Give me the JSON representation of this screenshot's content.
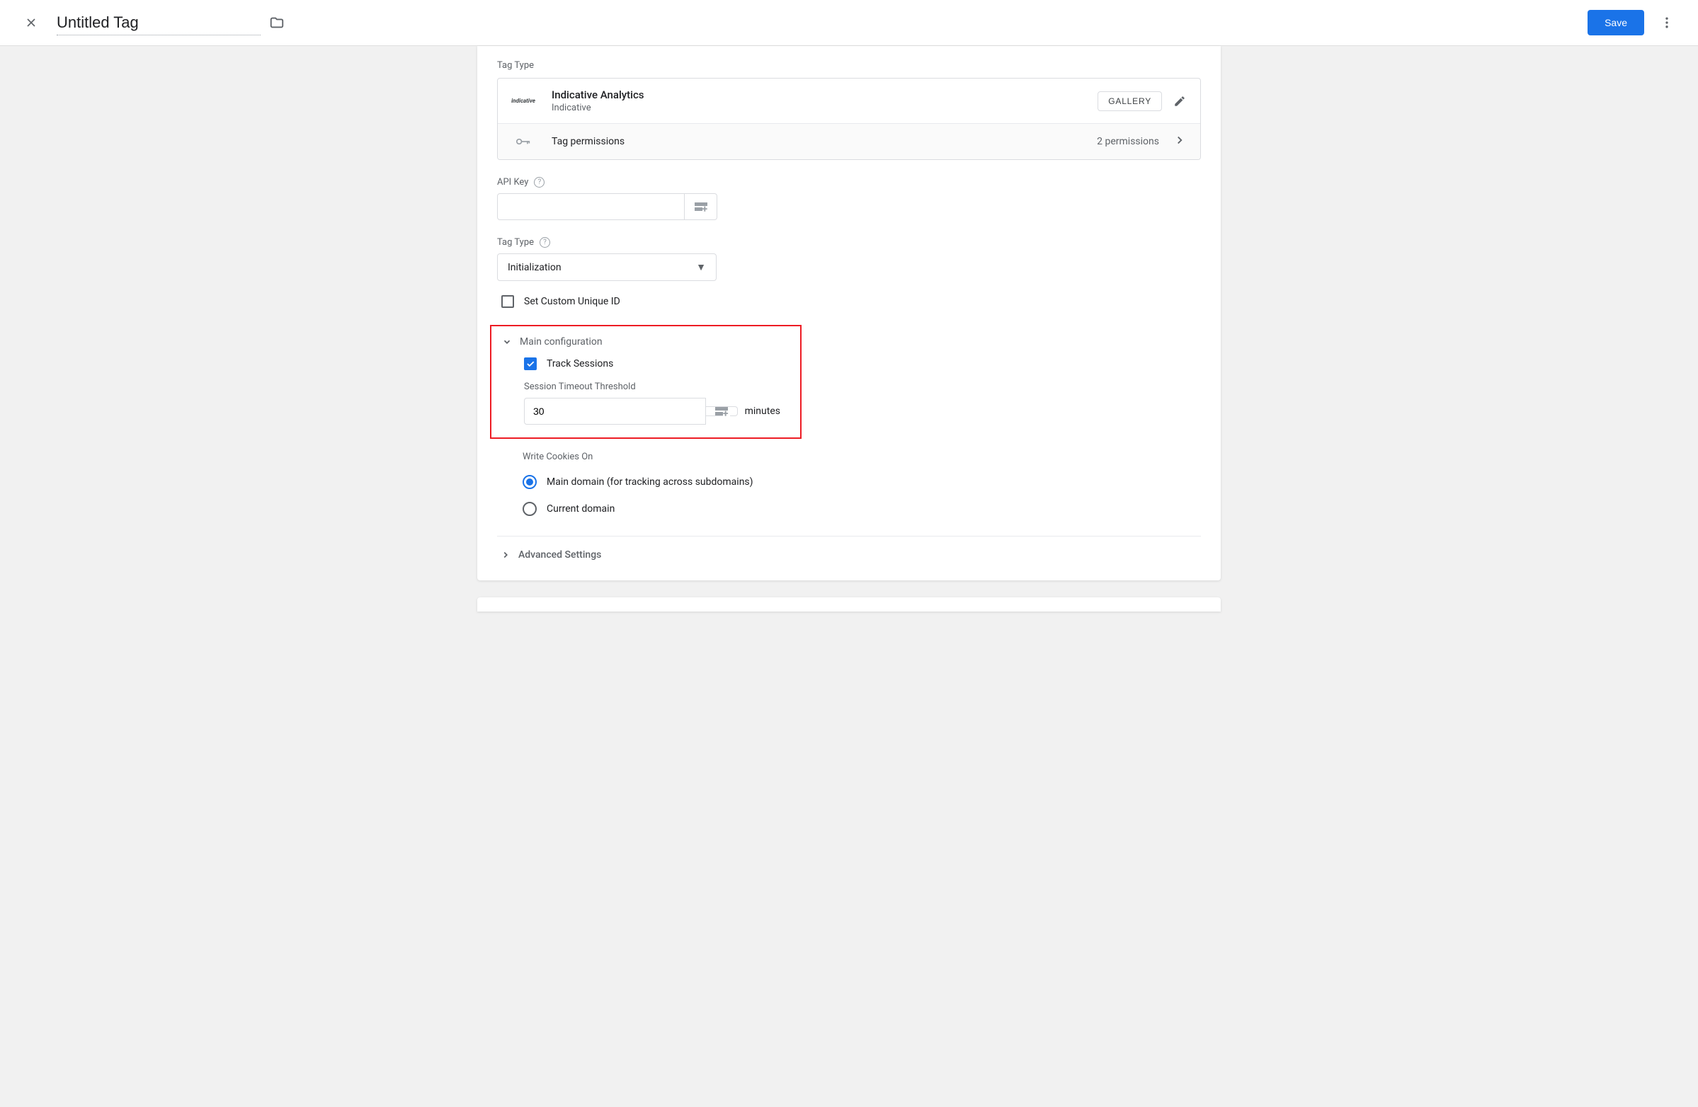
{
  "header": {
    "title": "Untitled Tag",
    "save_label": "Save"
  },
  "tagType": {
    "sectionLabel": "Tag Type",
    "name": "Indicative Analytics",
    "vendor": "Indicative",
    "galleryLabel": "GALLERY",
    "permissionsLabel": "Tag permissions",
    "permissionsCount": "2 permissions"
  },
  "apiKey": {
    "label": "API Key",
    "value": ""
  },
  "tagTypeField": {
    "label": "Tag Type",
    "value": "Initialization"
  },
  "customId": {
    "label": "Set Custom Unique ID"
  },
  "mainConfig": {
    "label": "Main configuration",
    "trackSessions": "Track Sessions",
    "sessionTimeoutLabel": "Session Timeout Threshold",
    "sessionTimeoutValue": "30",
    "minutesLabel": "minutes"
  },
  "cookies": {
    "label": "Write Cookies On",
    "mainDomain": "Main domain (for tracking across subdomains)",
    "currentDomain": "Current domain"
  },
  "advanced": {
    "label": "Advanced Settings"
  }
}
